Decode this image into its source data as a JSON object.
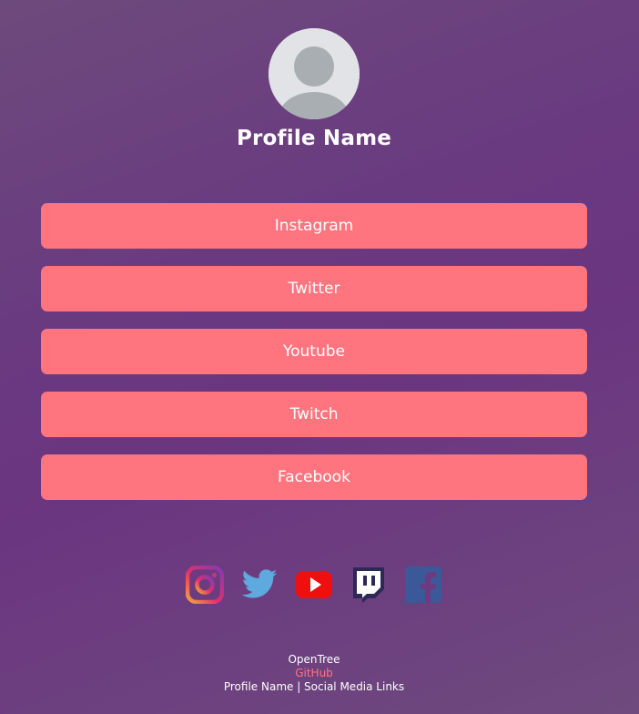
{
  "profile": {
    "name": "Profile Name",
    "avatar_icon": "default-user-avatar-icon"
  },
  "links": [
    {
      "label": "Instagram"
    },
    {
      "label": "Twitter"
    },
    {
      "label": "Youtube"
    },
    {
      "label": "Twitch"
    },
    {
      "label": "Facebook"
    }
  ],
  "socials": [
    {
      "icon": "instagram-icon"
    },
    {
      "icon": "twitter-icon"
    },
    {
      "icon": "youtube-icon"
    },
    {
      "icon": "twitch-icon"
    },
    {
      "icon": "facebook-icon"
    }
  ],
  "footer": {
    "brand": "OpenTree",
    "github_link": "GitHub",
    "tagline": "Profile Name | Social Media Links"
  },
  "colors": {
    "button": "#ff757f",
    "background": "#6b3a80",
    "text": "#ffffff"
  }
}
